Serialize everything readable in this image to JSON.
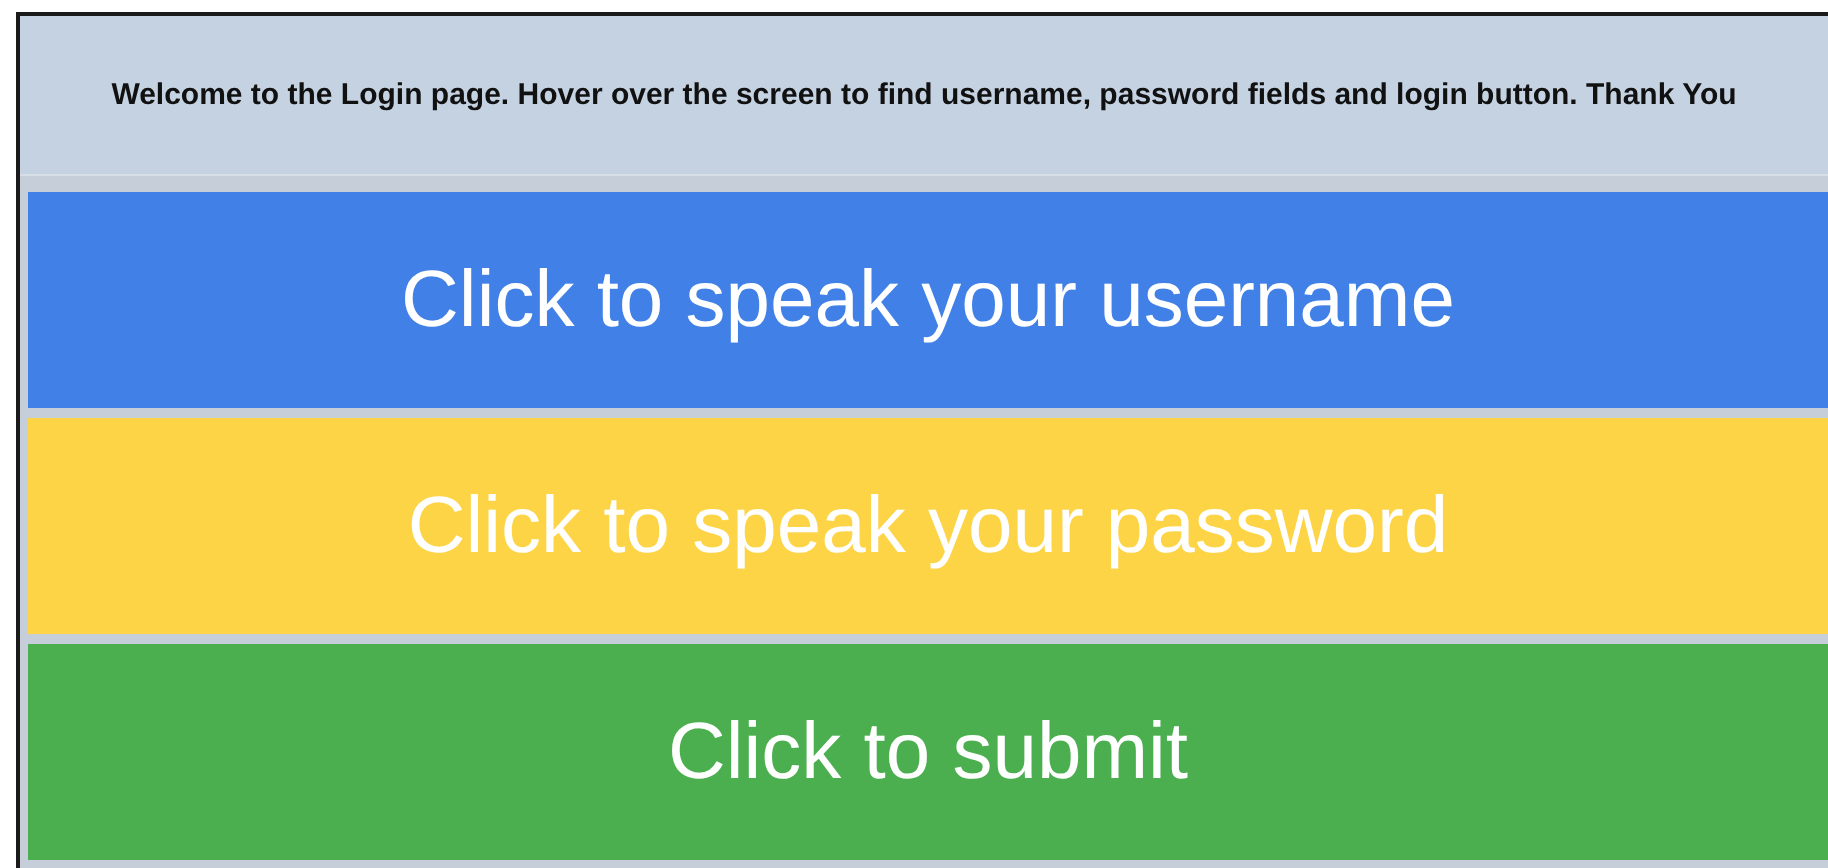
{
  "banner": {
    "text": "Welcome to the Login page. Hover over the screen to find username, password fields and login button. Thank You"
  },
  "buttons": [
    {
      "label": "Click to speak your username",
      "color": "#4180e7"
    },
    {
      "label": "Click to speak your password",
      "color": "#fdd446"
    },
    {
      "label": "Click to submit",
      "color": "#4baf50"
    }
  ]
}
